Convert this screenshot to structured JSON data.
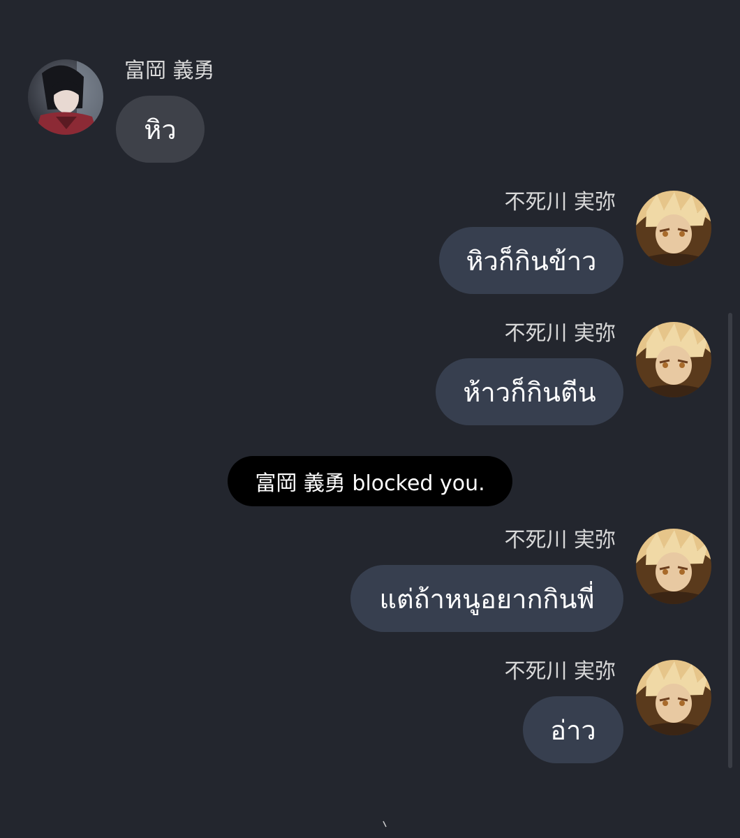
{
  "conversation": {
    "messages": [
      {
        "sender": "富岡 義勇",
        "text": "หิว",
        "direction": "incoming"
      },
      {
        "sender": "不死川 実弥",
        "text": "หิวก็กินข้าว",
        "direction": "outgoing"
      },
      {
        "sender": "不死川 実弥",
        "text": "ห้าวก็กินตีน",
        "direction": "outgoing"
      },
      {
        "sender": "不死川 実弥",
        "text": "แต่ถ้าหนูอยากกินพี่",
        "direction": "outgoing"
      },
      {
        "sender": "不死川 実弥",
        "text": "อ่าว",
        "direction": "outgoing"
      }
    ],
    "system_notice": "富岡 義勇 blocked you."
  },
  "icons": {
    "incoming_avatar": "avatar-image",
    "outgoing_avatar": "avatar-image",
    "footer": "handle-icon"
  },
  "colors": {
    "background": "#23262e",
    "incoming_bubble": "#3e4149",
    "outgoing_bubble": "#373f4f",
    "notice_bubble": "#000000"
  }
}
